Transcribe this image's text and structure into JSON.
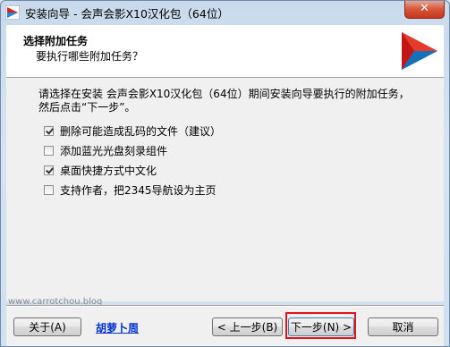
{
  "window": {
    "title": "安装向导 - 会声会影X10汉化包（64位）",
    "close_label": "✕"
  },
  "header": {
    "title": "选择附加任务",
    "subtitle": "要执行哪些附加任务？"
  },
  "content": {
    "intro_line1": "请选择在安装 会声会影X10汉化包（64位）期间安装向导要执行的附加任务，",
    "intro_line2": "然后点击“下一步”。",
    "options": [
      {
        "label": "删除可能造成乱码的文件（建议）",
        "checked": true
      },
      {
        "label": "添加蓝光光盘刻录组件",
        "checked": false
      },
      {
        "label": "桌面快捷方式中文化",
        "checked": true
      },
      {
        "label": "支持作者，把2345导航设为主页",
        "checked": false
      }
    ],
    "watermark": "www.carrotchou.blog"
  },
  "footer": {
    "about_label": "关于(A)",
    "author_link": "胡萝卜周",
    "back_label": "< 上一步(B)",
    "next_label": "下一步(N) >",
    "cancel_label": "取消"
  },
  "colors": {
    "logo_red": "#d81e1e",
    "logo_blue": "#1c8ad6",
    "highlight": "#e0141a",
    "link": "#0033cc"
  }
}
